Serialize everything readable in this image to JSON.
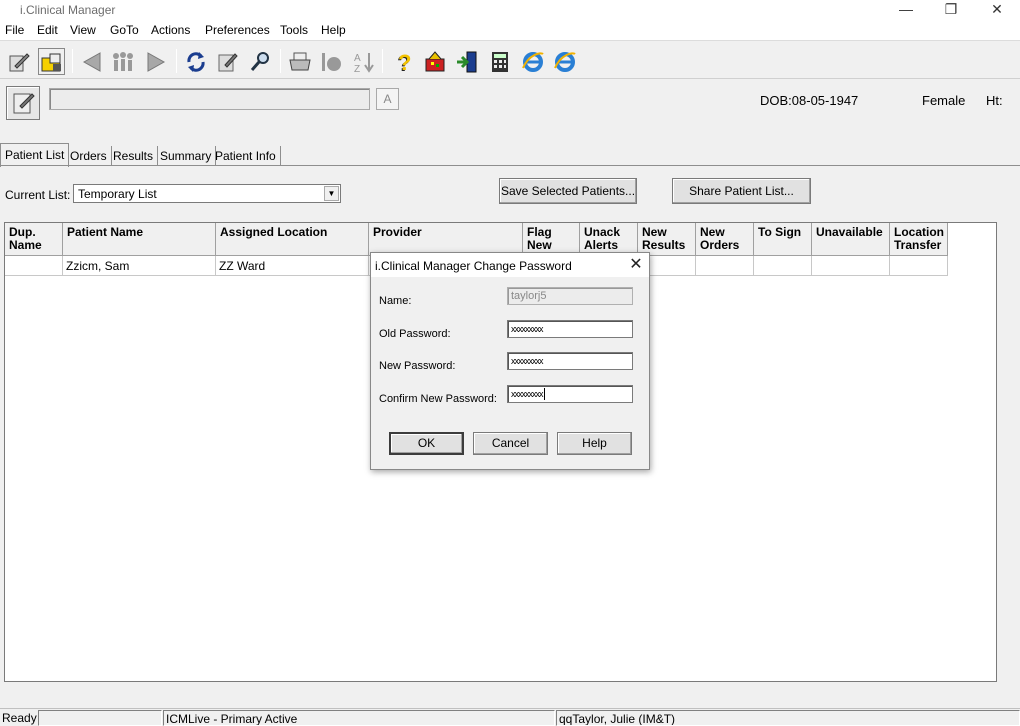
{
  "window": {
    "title": "i.Clinical Manager",
    "minimize": "—",
    "restore": "❐",
    "close": "✕"
  },
  "menu": [
    "File",
    "Edit",
    "View",
    "GoTo",
    "Actions",
    "Preferences",
    "Tools",
    "Help"
  ],
  "toolbar": {
    "icons": [
      "patient-select-icon",
      "folder-lock-icon",
      "back-arrow-icon",
      "people-icon",
      "forward-arrow-icon",
      "refresh-icon",
      "clipboard-edit-icon",
      "search-people-icon",
      "printer-icon",
      "bell-icon",
      "sort-az-icon",
      "help-icon",
      "palette-icon",
      "exit-icon",
      "calculator-icon",
      "browser-icon",
      "browser-alt-icon"
    ]
  },
  "patient_strip": {
    "a_label": "A",
    "dob": "DOB:08-05-1947",
    "gender": "Female",
    "ht": "Ht:"
  },
  "tabs": [
    "Patient List",
    "Orders",
    "Results",
    "Summary",
    "Patient Info"
  ],
  "current_list": {
    "label": "Current List:",
    "value": "Temporary List"
  },
  "buttons": {
    "save": "Save Selected Patients...",
    "share": "Share Patient List..."
  },
  "grid": {
    "columns": [
      {
        "l1": "Dup.",
        "l2": "Name"
      },
      {
        "l1": "Patient Name",
        "l2": ""
      },
      {
        "l1": "Assigned Location",
        "l2": ""
      },
      {
        "l1": "Provider",
        "l2": ""
      },
      {
        "l1": "Flag",
        "l2": "New"
      },
      {
        "l1": "Unack",
        "l2": "Alerts"
      },
      {
        "l1": "New",
        "l2": "Results"
      },
      {
        "l1": "New",
        "l2": "Orders"
      },
      {
        "l1": "To Sign",
        "l2": ""
      },
      {
        "l1": "Unavailable",
        "l2": ""
      },
      {
        "l1": "Location",
        "l2": "Transfer"
      }
    ],
    "rows": [
      [
        "",
        "Zzicm, Sam",
        "ZZ Ward",
        "",
        "",
        "",
        "",
        "",
        "",
        "",
        ""
      ]
    ]
  },
  "statusbar": {
    "ready": "Ready",
    "blank": "",
    "server": "ICMLive - Primary Active",
    "user": "qqTaylor, Julie (IM&T)"
  },
  "dialog": {
    "title": "i.Clinical Manager Change Password",
    "name_label": "Name:",
    "name_value": "taylorj5",
    "old_label": "Old Password:",
    "old_value": "xxxxxxxxx",
    "new_label": "New Password:",
    "new_value": "xxxxxxxxx",
    "confirm_label": "Confirm New Password:",
    "confirm_value": "xxxxxxxxx",
    "ok": "OK",
    "cancel": "Cancel",
    "help": "Help"
  }
}
